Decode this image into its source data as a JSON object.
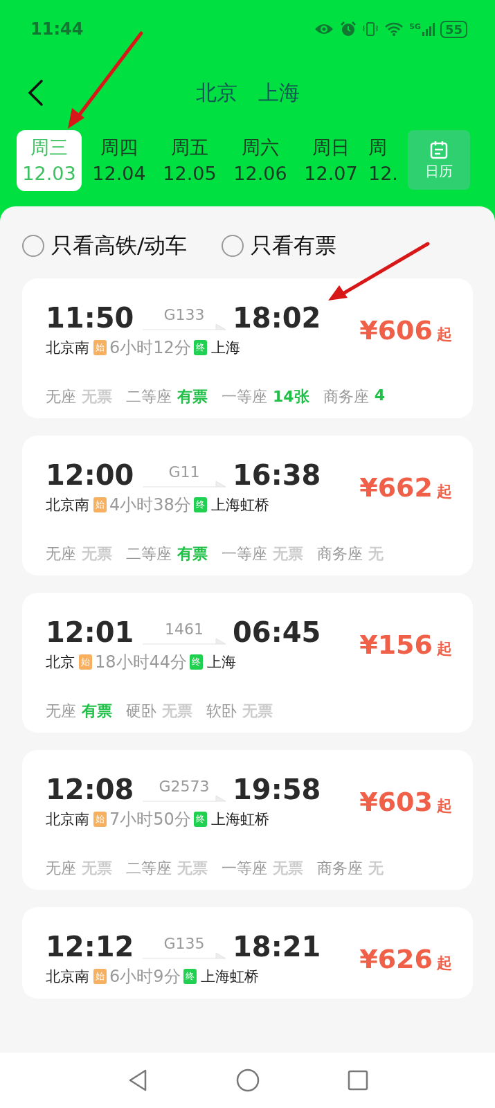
{
  "status_bar": {
    "time": "11:44",
    "network": "5G",
    "battery": "55"
  },
  "header": {
    "title": "北京　上海"
  },
  "dates": [
    {
      "weekday": "周三",
      "date": "12.03",
      "selected": true
    },
    {
      "weekday": "周四",
      "date": "12.04",
      "selected": false
    },
    {
      "weekday": "周五",
      "date": "12.05",
      "selected": false
    },
    {
      "weekday": "周六",
      "date": "12.06",
      "selected": false
    },
    {
      "weekday": "周日",
      "date": "12.07",
      "selected": false
    },
    {
      "weekday": "周",
      "date": "12.",
      "selected": false
    }
  ],
  "calendar_button": {
    "label": "日历"
  },
  "filters": [
    {
      "label": "只看高铁/动车",
      "checked": false
    },
    {
      "label": "只看有票",
      "checked": false
    }
  ],
  "trains": [
    {
      "depart": "11:50",
      "number": "G133",
      "arrive": "18:02",
      "from": "北京南",
      "from_tag": "始",
      "duration": "6小时12分",
      "to_tag": "终",
      "to": "上海",
      "price": "¥606",
      "price_suffix": "起",
      "seats": [
        {
          "name": "无座",
          "status": "无票",
          "available": false
        },
        {
          "name": "二等座",
          "status": "有票",
          "available": true
        },
        {
          "name": "一等座",
          "status": "14张",
          "available": true
        },
        {
          "name": "商务座",
          "status": "4",
          "available": true
        }
      ]
    },
    {
      "depart": "12:00",
      "number": "G11",
      "arrive": "16:38",
      "from": "北京南",
      "from_tag": "始",
      "duration": "4小时38分",
      "to_tag": "终",
      "to": "上海虹桥",
      "price": "¥662",
      "price_suffix": "起",
      "seats": [
        {
          "name": "无座",
          "status": "无票",
          "available": false
        },
        {
          "name": "二等座",
          "status": "有票",
          "available": true
        },
        {
          "name": "一等座",
          "status": "无票",
          "available": false
        },
        {
          "name": "商务座",
          "status": "无",
          "available": false
        }
      ]
    },
    {
      "depart": "12:01",
      "number": "1461",
      "arrive": "06:45",
      "from": "北京",
      "from_tag": "始",
      "duration": "18小时44分",
      "to_tag": "终",
      "to": "上海",
      "price": "¥156",
      "price_suffix": "起",
      "seats": [
        {
          "name": "无座",
          "status": "有票",
          "available": true
        },
        {
          "name": "硬卧",
          "status": "无票",
          "available": false
        },
        {
          "name": "软卧",
          "status": "无票",
          "available": false
        }
      ]
    },
    {
      "depart": "12:08",
      "number": "G2573",
      "arrive": "19:58",
      "from": "北京南",
      "from_tag": "始",
      "duration": "7小时50分",
      "to_tag": "终",
      "to": "上海虹桥",
      "price": "¥603",
      "price_suffix": "起",
      "seats": [
        {
          "name": "无座",
          "status": "无票",
          "available": false
        },
        {
          "name": "二等座",
          "status": "无票",
          "available": false
        },
        {
          "name": "一等座",
          "status": "无票",
          "available": false
        },
        {
          "name": "商务座",
          "status": "无",
          "available": false
        }
      ]
    },
    {
      "depart": "12:12",
      "number": "G135",
      "arrive": "18:21",
      "from": "北京南",
      "from_tag": "始",
      "duration": "6小时9分",
      "to_tag": "终",
      "to": "上海虹桥",
      "price": "¥626",
      "price_suffix": "起"
    }
  ]
}
